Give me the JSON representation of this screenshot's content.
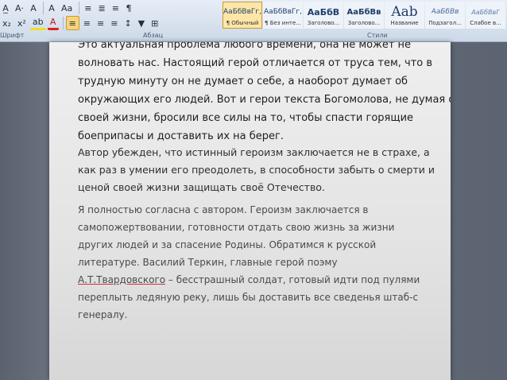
{
  "ribbon": {
    "row1_buttons": [
      "A̲",
      "A·",
      "A",
      "A",
      "Aa",
      "≡",
      "≣",
      "≡",
      "¶"
    ],
    "row2_buttons": [
      "x₂",
      "x²",
      "ab",
      "A",
      "≡",
      "≡",
      "≡",
      "≡",
      "↕",
      "▼",
      "⊞"
    ],
    "groups": {
      "font": "Шрифт",
      "paragraph": "Абзац",
      "styles": "Стили"
    },
    "styles": [
      {
        "preview": "АаБбВвГг,",
        "name": "¶ Обычный",
        "active": true
      },
      {
        "preview": "АаБбВвГг,",
        "name": "¶ Без инте...",
        "active": false
      },
      {
        "preview": "АаБбВ",
        "name": "Заголово...",
        "active": false
      },
      {
        "preview": "АаБбВв",
        "name": "Заголово...",
        "active": false
      },
      {
        "preview": "Aab",
        "name": "Название",
        "active": false
      },
      {
        "preview": "АаБбВв",
        "name": "Подзагол...",
        "active": false
      },
      {
        "preview": "АаБбВвГ",
        "name": "Слабое в...",
        "active": false
      }
    ]
  },
  "document": {
    "paragraph1": [
      "Это актуальная проблема любого времени, она не может не",
      "волновать нас. Настоящий герой отличается от труса тем, что в",
      "трудную минуту он не думает о себе, а наоборот думает об",
      "окружающих его людей. Вот и герои текста Богомолова, не думая о",
      "своей жизни, бросили все силы на то, чтобы спасти горящие",
      "боеприпасы и доставить их на берег."
    ],
    "paragraph2": [
      "Автор убежден, что истинный героизм заключается не в страхе, а",
      "как раз в умении его преодолеть, в способности забыть о смерти и",
      "ценой своей жизни защищать своё Отечество."
    ],
    "paragraph3": {
      "lines": [
        "Я полностью согласна с автором. Героизм заключается в",
        "самопожертвовании, готовности отдать свою жизнь за жизни",
        "других людей и за спасение Родины. Обратимся к русской",
        "литературе. Василий Теркин, главные герой поэму"
      ],
      "link": "А.Т.Твардовского",
      "line5_rest": " – бесстрашный солдат, готовый идти под пулями",
      "tail": [
        "переплыть ледяную реку, лишь бы доставить все сведенья штаб-с",
        "генералу."
      ]
    }
  }
}
